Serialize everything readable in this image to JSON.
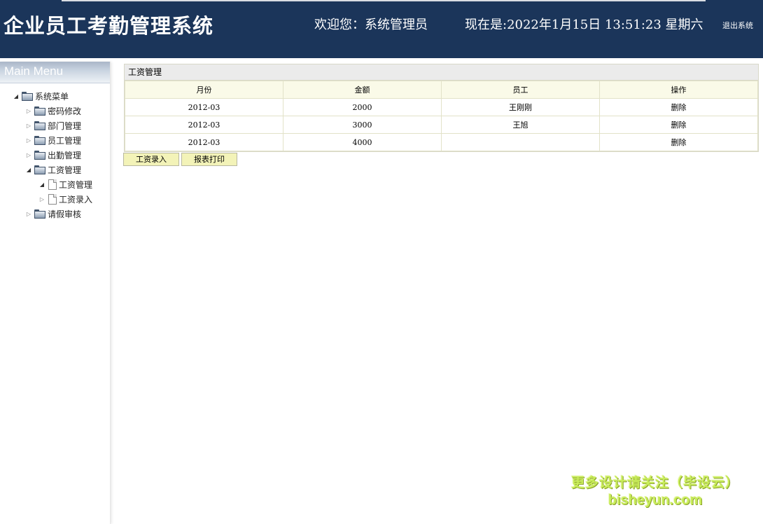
{
  "header": {
    "title": "企业员工考勤管理系统",
    "welcome": "欢迎您：系统管理员",
    "datetime": "现在是:2022年1月15日 13:51:23 星期六",
    "logout": "退出系统"
  },
  "sidebar": {
    "heading": "Main Menu",
    "root": "系统菜单",
    "items": [
      {
        "label": "密码修改",
        "expanded": false
      },
      {
        "label": "部门管理",
        "expanded": false
      },
      {
        "label": "员工管理",
        "expanded": false
      },
      {
        "label": "出勤管理",
        "expanded": false
      },
      {
        "label": "工资管理",
        "expanded": true
      },
      {
        "label": "请假审核",
        "expanded": false
      }
    ],
    "subitems": [
      {
        "label": "工资管理"
      },
      {
        "label": "工资录入"
      }
    ]
  },
  "panel": {
    "title": "工资管理",
    "columns": [
      "月份",
      "金额",
      "员工",
      "操作"
    ],
    "rows": [
      {
        "month": "2012-03",
        "amount": "2000",
        "employee": "王刚刚",
        "action": "删除"
      },
      {
        "month": "2012-03",
        "amount": "3000",
        "employee": "王旭",
        "action": "删除"
      },
      {
        "month": "2012-03",
        "amount": "4000",
        "employee": "",
        "action": "删除"
      }
    ]
  },
  "buttons": {
    "add": "工资录入",
    "print": "报表打印"
  },
  "watermark": {
    "line1": "更多设计请关注（毕设云）",
    "line2": "bisheyun.com"
  },
  "colors": {
    "header_bg": "#1b355a",
    "button_bg": "#f3f3b8",
    "table_header_bg": "#fafae8"
  }
}
